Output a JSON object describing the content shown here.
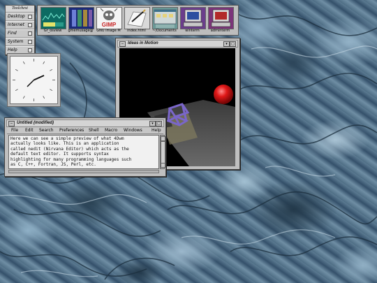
{
  "toolchest": {
    "title": "Toolchest",
    "items": [
      "Desktop",
      "Internet",
      "Find",
      "System",
      "Help"
    ]
  },
  "icon_panel": {
    "icons": [
      {
        "label": "Gr_osview",
        "icon": "osview-monitor-icon"
      },
      {
        "label": "gmemusage@",
        "icon": "memusage-bars-icon"
      },
      {
        "label": "GNU Image M",
        "icon": "gimp-icon"
      },
      {
        "label": "index.html",
        "icon": "document-pen-icon"
      },
      {
        "label": "~/Documents",
        "icon": "documents-folder-icon"
      },
      {
        "label": "winterm",
        "icon": "terminal-icon"
      },
      {
        "label": "adminterm",
        "icon": "admin-terminal-icon"
      }
    ],
    "gimp_badge": "GIMP"
  },
  "ideas_window": {
    "title": "Ideas in Motion"
  },
  "nedit_window": {
    "title": "Untitled (modified)",
    "menu": [
      "File",
      "Edit",
      "Search",
      "Preferences",
      "Shell",
      "Macro",
      "Windows",
      "Help"
    ],
    "text_lines": [
      "Here we can see a simple preview of what 4Dwm",
      "actually looks like. This is an application",
      "called nedit (Nirvana Editor) which acts as the",
      "default text editor. It supports syntax",
      "highlighting for many programming languages such",
      "as C, C++, Fortran, JS, Perl, etc."
    ]
  },
  "colors": {
    "sphere": "#e01818",
    "cube": "#7a66c9",
    "window_gray": "#bfbfbf"
  }
}
